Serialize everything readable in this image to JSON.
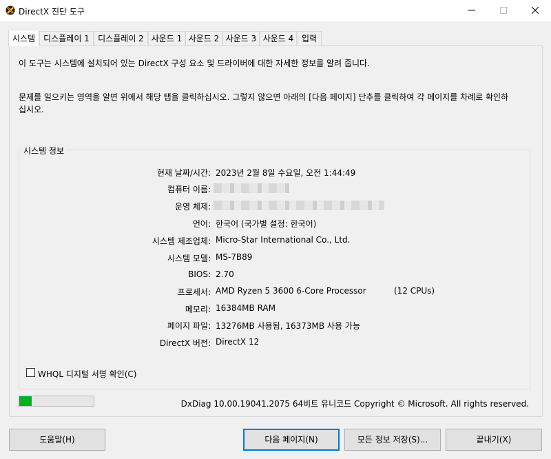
{
  "window": {
    "title": "DirectX 진단 도구"
  },
  "tabs": [
    "시스템",
    "디스플레이 1",
    "디스플레이 2",
    "사운드 1",
    "사운드 2",
    "사운드 3",
    "사운드 4",
    "입력"
  ],
  "intro": {
    "line1": "이 도구는 시스템에 설치되어 있는 DirectX 구성 요소 및 드라이버에 대한 자세한 정보를 알려 줍니다.",
    "line2": "문제를 일으키는 영역을 알면 위에서 해당 탭을 클릭하십시오. 그렇지 않으면 아래의 [다음 페이지] 단추를 클릭하여 각 페이지를 차례로 확인하십시오."
  },
  "system_info": {
    "group_title": "시스템 정보",
    "rows": [
      {
        "label": "현재 날짜/시간:",
        "value": "2023년 2월 8일 수요일, 오전 1:44:49"
      },
      {
        "label": "컴퓨터 이름:",
        "value": ""
      },
      {
        "label": "운영 체제:",
        "value": ""
      },
      {
        "label": "언어:",
        "value": "한국어 (국가별 설정: 한국어)"
      },
      {
        "label": "시스템 제조업체:",
        "value": "Micro-Star International Co., Ltd."
      },
      {
        "label": "시스템 모델:",
        "value": "MS-7B89"
      },
      {
        "label": "BIOS:",
        "value": "2.70"
      },
      {
        "label": "프로세서:",
        "value": "AMD Ryzen 5 3600 6-Core Processor",
        "extra": "(12 CPUs)"
      },
      {
        "label": "메모리:",
        "value": "16384MB RAM"
      },
      {
        "label": "페이지 파일:",
        "value": "13276MB 사용됨, 16373MB 사용 가능"
      },
      {
        "label": "DirectX 버전:",
        "value": "DirectX 12"
      }
    ]
  },
  "whql": {
    "label": "WHQL 디지털 서명 확인(C)",
    "checked": false
  },
  "progress": {
    "fraction": 0.17,
    "color": "#06b025"
  },
  "footer_info": "DxDiag 10.00.19041.2075 64비트 유니코드  Copyright © Microsoft. All rights reserved.",
  "buttons": {
    "help": "도움말(H)",
    "next": "다음 페이지(N)",
    "save_all": "모든 정보 저장(S)...",
    "exit": "끝내기(X)"
  },
  "colors": {
    "accent": "#0078d7",
    "progress": "#06b025"
  }
}
